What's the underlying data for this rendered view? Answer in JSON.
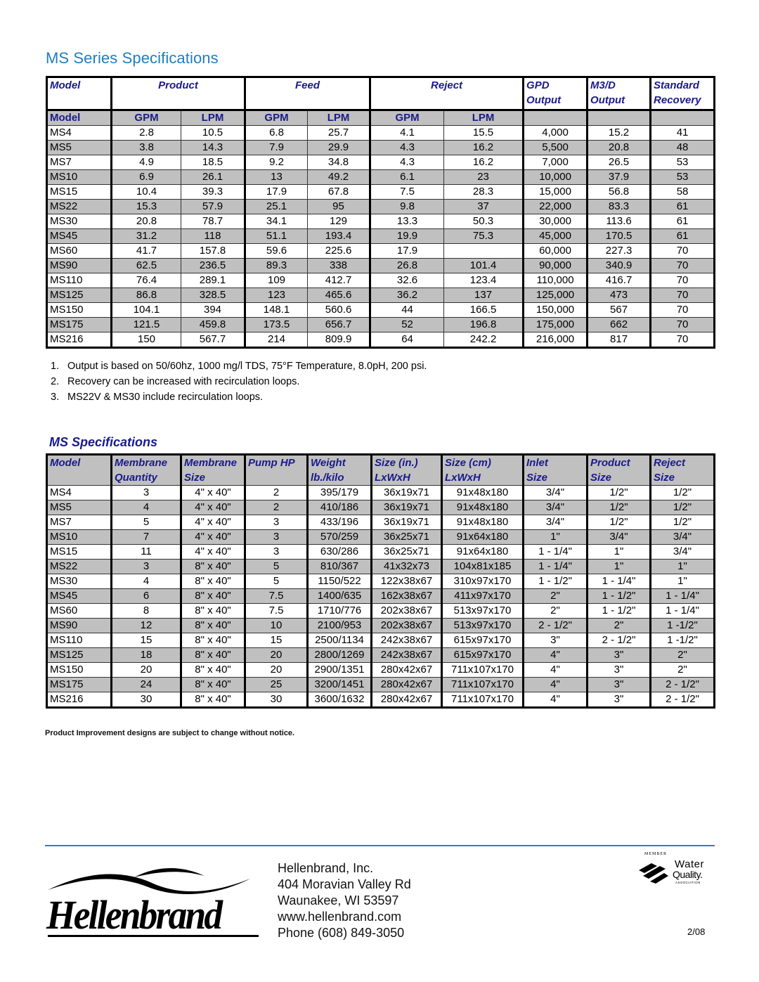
{
  "title": "MS Series Specifications",
  "table1": {
    "header_top": [
      "Model",
      "Product",
      "Feed",
      "Reject",
      "GPD\nOutput",
      "M3/D\nOutput",
      "Standard\nRecovery"
    ],
    "header_top_labels": {
      "model": "Model",
      "product": "Product",
      "feed": "Feed",
      "reject": "Reject",
      "gpd_1": "GPD",
      "gpd_2": "Output",
      "m3d_1": "M3/D",
      "m3d_2": "Output",
      "recovery_1": "Standard",
      "recovery_2": "Recovery"
    },
    "header_sub": [
      "Model",
      "GPM",
      "LPM",
      "GPM",
      "LPM",
      "GPM",
      "LPM",
      "",
      "",
      ""
    ],
    "rows": [
      [
        "MS4",
        "2.8",
        "10.5",
        "6.8",
        "25.7",
        "4.1",
        "15.5",
        "4,000",
        "15.2",
        "41"
      ],
      [
        "MS5",
        "3.8",
        "14.3",
        "7.9",
        "29.9",
        "4.3",
        "16.2",
        "5,500",
        "20.8",
        "48"
      ],
      [
        "MS7",
        "4.9",
        "18.5",
        "9.2",
        "34.8",
        "4.3",
        "16.2",
        "7,000",
        "26.5",
        "53"
      ],
      [
        "MS10",
        "6.9",
        "26.1",
        "13",
        "49.2",
        "6.1",
        "23",
        "10,000",
        "37.9",
        "53"
      ],
      [
        "MS15",
        "10.4",
        "39.3",
        "17.9",
        "67.8",
        "7.5",
        "28.3",
        "15,000",
        "56.8",
        "58"
      ],
      [
        "MS22",
        "15.3",
        "57.9",
        "25.1",
        "95",
        "9.8",
        "37",
        "22,000",
        "83.3",
        "61"
      ],
      [
        "MS30",
        "20.8",
        "78.7",
        "34.1",
        "129",
        "13.3",
        "50.3",
        "30,000",
        "113.6",
        "61"
      ],
      [
        "MS45",
        "31.2",
        "118",
        "51.1",
        "193.4",
        "19.9",
        "75.3",
        "45,000",
        "170.5",
        "61"
      ],
      [
        "MS60",
        "41.7",
        "157.8",
        "59.6",
        "225.6",
        "17.9",
        "",
        "60,000",
        "227.3",
        "70"
      ],
      [
        "MS90",
        "62.5",
        "236.5",
        "89.3",
        "338",
        "26.8",
        "101.4",
        "90,000",
        "340.9",
        "70"
      ],
      [
        "MS110",
        "76.4",
        "289.1",
        "109",
        "412.7",
        "32.6",
        "123.4",
        "110,000",
        "416.7",
        "70"
      ],
      [
        "MS125",
        "86.8",
        "328.5",
        "123",
        "465.6",
        "36.2",
        "137",
        "125,000",
        "473",
        "70"
      ],
      [
        "MS150",
        "104.1",
        "394",
        "148.1",
        "560.6",
        "44",
        "166.5",
        "150,000",
        "567",
        "70"
      ],
      [
        "MS175",
        "121.5",
        "459.8",
        "173.5",
        "656.7",
        "52",
        "196.8",
        "175,000",
        "662",
        "70"
      ],
      [
        "MS216",
        "150",
        "567.7",
        "214",
        "809.9",
        "64",
        "242.2",
        "216,000",
        "817",
        "70"
      ]
    ]
  },
  "notes": [
    {
      "num": "1.",
      "text": "Output is based on 50/60hz, 1000 mg/l TDS, 75°F Temperature, 8.0pH, 200 psi."
    },
    {
      "num": "2.",
      "text": "Recovery can be increased with recirculation loops."
    },
    {
      "num": "3.",
      "text": "MS22V & MS30 include recirculation loops."
    }
  ],
  "subtitle": "MS Specifications",
  "table2": {
    "header_line1": [
      "Model",
      "Membrane",
      "Membrane",
      "Pump HP",
      "Weight",
      "Size (in.)",
      "Size (cm)",
      "Inlet",
      "Product",
      "Reject"
    ],
    "header_line2": [
      "",
      "Quantity",
      "Size",
      "",
      "lb./kilo",
      "LxWxH",
      "LxWxH",
      "Size",
      "Size",
      "Size"
    ],
    "rows": [
      [
        "MS4",
        "3",
        "4\" x 40\"",
        "2",
        "395/179",
        "36x19x71",
        "91x48x180",
        "3/4\"",
        "1/2\"",
        "1/2\""
      ],
      [
        "MS5",
        "4",
        "4\" x 40\"",
        "2",
        "410/186",
        "36x19x71",
        "91x48x180",
        "3/4\"",
        "1/2\"",
        "1/2\""
      ],
      [
        "MS7",
        "5",
        "4\" x 40\"",
        "3",
        "433/196",
        "36x19x71",
        "91x48x180",
        "3/4\"",
        "1/2\"",
        "1/2\""
      ],
      [
        "MS10",
        "7",
        "4\" x 40\"",
        "3",
        "570/259",
        "36x25x71",
        "91x64x180",
        "1\"",
        "3/4\"",
        "3/4\""
      ],
      [
        "MS15",
        "11",
        "4\" x 40\"",
        "3",
        "630/286",
        "36x25x71",
        "91x64x180",
        "1 - 1/4\"",
        "1\"",
        "3/4\""
      ],
      [
        "MS22",
        "3",
        "8\" x 40\"",
        "5",
        "810/367",
        "41x32x73",
        "104x81x185",
        "1 - 1/4\"",
        "1\"",
        "1\""
      ],
      [
        "MS30",
        "4",
        "8\" x 40\"",
        "5",
        "1150/522",
        "122x38x67",
        "310x97x170",
        "1 - 1/2\"",
        "1 - 1/4\"",
        "1\""
      ],
      [
        "MS45",
        "6",
        "8\" x 40\"",
        "7.5",
        "1400/635",
        "162x38x67",
        "411x97x170",
        "2\"",
        "1 - 1/2\"",
        "1 - 1/4\""
      ],
      [
        "MS60",
        "8",
        "8\" x 40\"",
        "7.5",
        "1710/776",
        "202x38x67",
        "513x97x170",
        "2\"",
        "1 - 1/2\"",
        "1 - 1/4\""
      ],
      [
        "MS90",
        "12",
        "8\" x 40\"",
        "10",
        "2100/953",
        "202x38x67",
        "513x97x170",
        "2 - 1/2\"",
        "2\"",
        "1 -1/2\""
      ],
      [
        "MS110",
        "15",
        "8\" x 40\"",
        "15",
        "2500/1134",
        "242x38x67",
        "615x97x170",
        "3\"",
        "2 - 1/2\"",
        "1 -1/2\""
      ],
      [
        "MS125",
        "18",
        "8\" x 40\"",
        "20",
        "2800/1269",
        "242x38x67",
        "615x97x170",
        "4\"",
        "3\"",
        "2\""
      ],
      [
        "MS150",
        "20",
        "8\" x 40\"",
        "20",
        "2900/1351",
        "280x42x67",
        "711x107x170",
        "4\"",
        "3\"",
        "2\""
      ],
      [
        "MS175",
        "24",
        "8\" x 40\"",
        "25",
        "3200/1451",
        "280x42x67",
        "711x107x170",
        "4\"",
        "3\"",
        "2 - 1/2\""
      ],
      [
        "MS216",
        "30",
        "8\" x 40\"",
        "30",
        "3600/1632",
        "280x42x67",
        "711x107x170",
        "4\"",
        "3\"",
        "2 - 1/2\""
      ]
    ]
  },
  "disclaimer": "Product Improvement designs are subject to change without notice.",
  "footer": {
    "logo_text": "Hellenbrand",
    "address_lines": [
      "Hellenbrand, Inc.",
      "404 Moravian Valley Rd",
      "Waunakee, WI  53597",
      "www.hellenbrand.com",
      "Phone (608) 849-3050"
    ],
    "wqa": {
      "member": "MEMBER",
      "water": "Water",
      "quality": "Quality.",
      "association": "ASSOCIATION",
      "icon": "wqa-wave-icon"
    },
    "date": "2/08"
  },
  "colors": {
    "title_blue": "#1f7ec1",
    "header_navy": "#1a1a8c",
    "row_gray": "#c0c0c0",
    "rule_blue": "#2f7fc4"
  }
}
